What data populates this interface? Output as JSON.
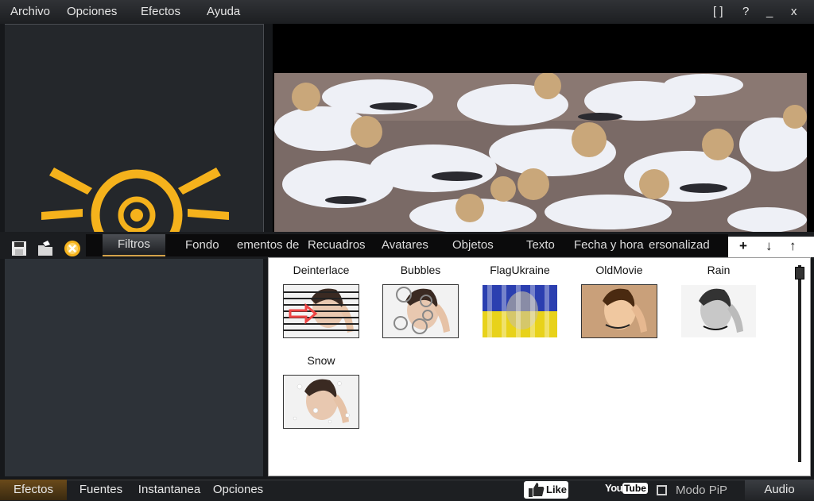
{
  "menu": {
    "items": [
      "Archivo",
      "Opciones",
      "Efectos",
      "Ayuda"
    ]
  },
  "window_controls": {
    "maximize": "[ ]",
    "help": "?",
    "minimize": "_",
    "close": "x"
  },
  "toolbar_icons": [
    "save-icon",
    "open-folder-icon",
    "close-circle-icon"
  ],
  "tabs": [
    {
      "label": "Filtros",
      "active": true
    },
    {
      "label": "Fondo"
    },
    {
      "label": "ementos de"
    },
    {
      "label": "Recuadros"
    },
    {
      "label": "Avatares"
    },
    {
      "label": "Objetos"
    },
    {
      "label": "Texto"
    },
    {
      "label": "Fecha y hora"
    },
    {
      "label": "ersonalizad"
    }
  ],
  "tools": {
    "add": "+",
    "down": "↓",
    "up": "↑"
  },
  "filters": [
    {
      "label": "Deinterlace"
    },
    {
      "label": "Bubbles"
    },
    {
      "label": "FlagUkraine"
    },
    {
      "label": "OldMovie"
    },
    {
      "label": "Rain"
    },
    {
      "label": "Snow"
    }
  ],
  "bottom_tabs": [
    {
      "label": "Efectos",
      "active": true
    },
    {
      "label": "Fuentes"
    },
    {
      "label": "Instantanea"
    },
    {
      "label": "Opciones"
    }
  ],
  "like_label": "Like",
  "youtube": {
    "you": "You",
    "tube": "Tube"
  },
  "pip": {
    "label": "Modo PiP",
    "checked": false
  },
  "audio_label": "Audio",
  "colors": {
    "accent": "#f5b21c",
    "background": "#16181b",
    "panel": "#2d3238"
  }
}
